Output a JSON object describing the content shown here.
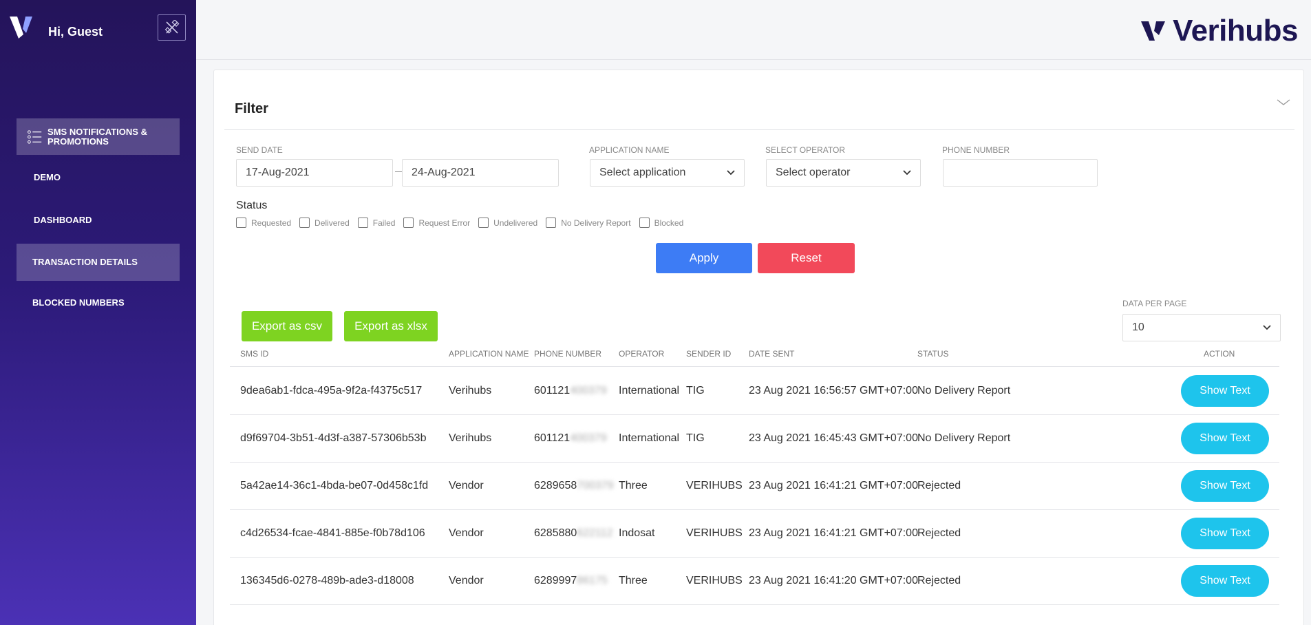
{
  "sidebar": {
    "greeting": "Hi, Guest",
    "items": [
      {
        "label": "SMS NOTIFICATIONS & PROMOTIONS"
      },
      {
        "label": "DEMO"
      },
      {
        "label": "DASHBOARD"
      },
      {
        "label": "TRANSACTION DETAILS"
      },
      {
        "label": "BLOCKED NUMBERS"
      }
    ]
  },
  "header": {
    "brand": "Verihubs"
  },
  "filter": {
    "title": "Filter",
    "send_date_label": "SEND DATE",
    "date_from": "17-Aug-2021",
    "date_to": "24-Aug-2021",
    "application_label": "APPLICATION NAME",
    "application_value": "Select application",
    "operator_label": "SELECT OPERATOR",
    "operator_value": "Select operator",
    "phone_label": "PHONE NUMBER",
    "phone_value": "",
    "status_label": "Status",
    "statuses": [
      "Requested",
      "Delivered",
      "Failed",
      "Request Error",
      "Undelivered",
      "No Delivery Report",
      "Blocked"
    ],
    "apply": "Apply",
    "reset": "Reset"
  },
  "export": {
    "csv": "Export as csv",
    "xlsx": "Export as xlsx"
  },
  "per_page": {
    "label": "DATA PER PAGE",
    "value": "10"
  },
  "table": {
    "columns": [
      "SMS ID",
      "APPLICATION NAME",
      "PHONE NUMBER",
      "OPERATOR",
      "SENDER ID",
      "DATE SENT",
      "STATUS",
      "ACTION"
    ],
    "rows": [
      {
        "id": "9dea6ab1-fdca-495a-9f2a-f4375c517",
        "app": "Verihubs",
        "phone": "601121",
        "phone_hidden": "400379",
        "operator": "International",
        "sender": "TIG",
        "date": "23 Aug 2021 16:56:57 GMT+07:00",
        "status": "No Delivery Report",
        "action": "Show Text"
      },
      {
        "id": "d9f69704-3b51-4d3f-a387-57306b53b",
        "app": "Verihubs",
        "phone": "601121",
        "phone_hidden": "400379",
        "operator": "International",
        "sender": "TIG",
        "date": "23 Aug 2021 16:45:43 GMT+07:00",
        "status": "No Delivery Report",
        "action": "Show Text"
      },
      {
        "id": "5a42ae14-36c1-4bda-be07-0d458c1fd",
        "app": "Vendor",
        "phone": "6289658",
        "phone_hidden": "700379",
        "operator": "Three",
        "sender": "VERIHUBS",
        "date": "23 Aug 2021 16:41:21 GMT+07:00",
        "status": "Rejected",
        "action": "Show Text"
      },
      {
        "id": "c4d26534-fcae-4841-885e-f0b78d106",
        "app": "Vendor",
        "phone": "6285880",
        "phone_hidden": "622112",
        "operator": "Indosat",
        "sender": "VERIHUBS",
        "date": "23 Aug 2021 16:41:21 GMT+07:00",
        "status": "Rejected",
        "action": "Show Text"
      },
      {
        "id": "136345d6-0278-489b-ade3-d18008",
        "app": "Vendor",
        "phone": "6289997",
        "phone_hidden": "86175",
        "operator": "Three",
        "sender": "VERIHUBS",
        "date": "23 Aug 2021 16:41:20 GMT+07:00",
        "status": "Rejected",
        "action": "Show Text"
      }
    ]
  },
  "colors": {
    "sidebar_top": "#24145a",
    "sidebar_bottom": "#4b31b5",
    "apply": "#3d7cf5",
    "reset": "#f2495a",
    "export": "#7ed321",
    "show_text": "#1ec4ec",
    "brand": "#1d1653"
  }
}
